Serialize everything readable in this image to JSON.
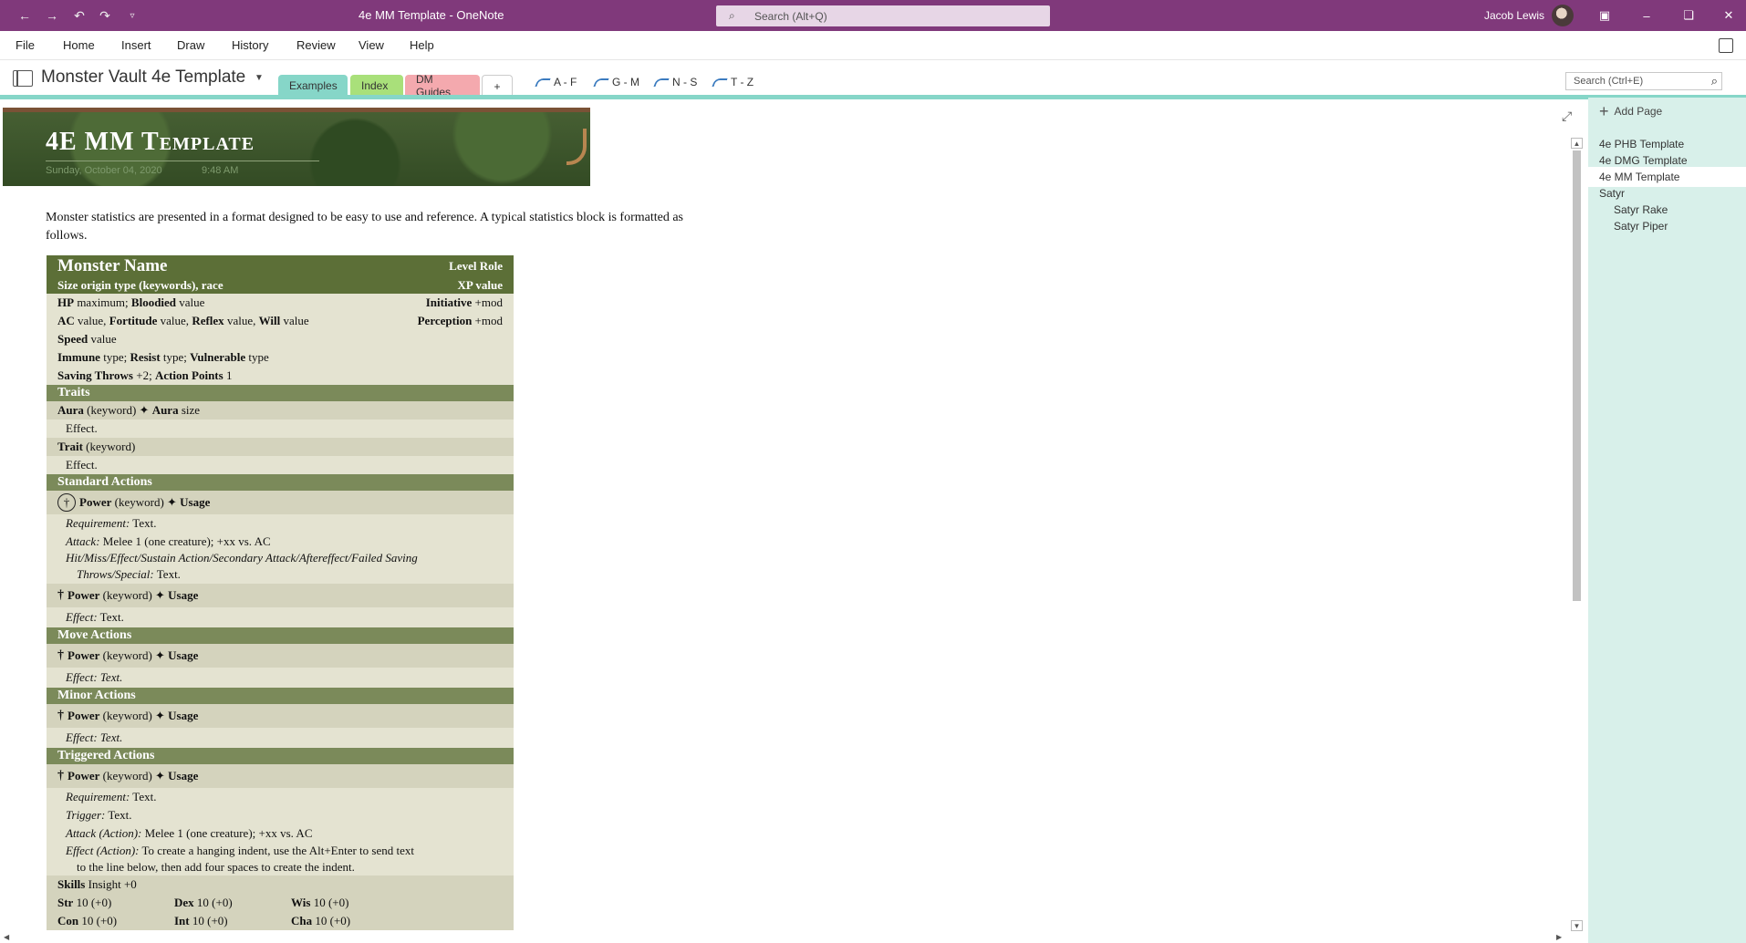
{
  "titlebar": {
    "title": "4e MM Template  -  OneNote",
    "search_placeholder": "Search (Alt+Q)",
    "user": "Jacob Lewis",
    "bg_color": "#80397b"
  },
  "menu": [
    "File",
    "Home",
    "Insert",
    "Draw",
    "History",
    "Review",
    "View",
    "Help"
  ],
  "notebook": {
    "name": "Monster Vault 4e Template",
    "sections": [
      {
        "label": "Examples",
        "color": "#86d6c8"
      },
      {
        "label": "Index",
        "color": "#a9e07a"
      },
      {
        "label": "DM Guides",
        "color": "#f4a9ae"
      }
    ],
    "add_label": "+",
    "groups": [
      "A - F",
      "G - M",
      "N - S",
      "T - Z"
    ],
    "page_search": "Search (Ctrl+E)"
  },
  "pages": {
    "add_label": "Add Page",
    "items": [
      {
        "label": "4e PHB Template",
        "level": 0
      },
      {
        "label": "4e DMG Template",
        "level": 0
      },
      {
        "label": "4e MM Template",
        "level": 0,
        "selected": true
      },
      {
        "label": "Satyr",
        "level": 0
      },
      {
        "label": "Satyr Rake",
        "level": 1
      },
      {
        "label": "Satyr Piper",
        "level": 1
      }
    ]
  },
  "page": {
    "title": "4E MM Template",
    "date": "Sunday, October 04, 2020",
    "time": "9:48 AM",
    "intro": "Monster statistics are presented in a format designed to be easy to use and reference. A typical statistics block is formatted as follows."
  },
  "statblock": {
    "name": "Monster Name",
    "level_role": "Level Role",
    "size_line": "Size origin type (keywords), race",
    "xp": "XP value",
    "hp_b": "HP",
    "hp_1": " maximum; ",
    "bloodied_b": "Bloodied",
    "bloodied_v": " value",
    "init_b": "Initiative",
    "init_v": " +mod",
    "ac_b": "AC",
    "ac_v": " value, ",
    "fort_b": "Fortitude",
    "fort_v": " value, ",
    "ref_b": "Reflex",
    "ref_v": " value, ",
    "will_b": "Will",
    "will_v": " value",
    "perc_b": "Perception",
    "perc_v": " +mod",
    "speed_b": "Speed",
    "speed_v": " value",
    "imm_b": "Immune",
    "imm_v": " type; ",
    "res_b": "Resist",
    "res_v": " type; ",
    "vul_b": "Vulnerable",
    "vul_v": " type",
    "st_b": "Saving Throws",
    "st_v": " +2; ",
    "ap_b": "Action Points",
    "ap_v": " 1",
    "traits": "Traits",
    "aura_b": "Aura",
    "aura_kw": " (keyword) ✦ ",
    "aura_b2": "Aura",
    "aura_sz": " size",
    "effect1": "Effect.",
    "trait_b": "Trait",
    "trait_kw": " (keyword)",
    "effect2": "Effect.",
    "standard": "Standard Actions",
    "power_b": "Power",
    "power_kw": " (keyword) ✦ ",
    "usage_b": "Usage",
    "req_i": "Requirement:",
    "req_t": " Text.",
    "attack_i": "Attack:",
    "attack_t": " Melee 1 (one creature); +xx vs. AC",
    "hit_i": "Hit/Miss/Effect/Sustain Action/Secondary Attack/Aftereffect/Failed Saving",
    "hit_i2": "Throws/Special:",
    "hit_t2": " Text.",
    "effect_i": "Effect:",
    "effect_t": " Text.",
    "move": "Move Actions",
    "effect_text_i": "Effect: Text.",
    "minor": "Minor Actions",
    "triggered": "Triggered Actions",
    "trigger_i": "Trigger:",
    "trigger_t": " Text.",
    "attack_action_i": "Attack (Action):",
    "effect_action_i": "Effect (Action):",
    "effect_action_t": " To create a hanging indent, use the Alt+Enter to send text",
    "effect_action_t2": "to the line below, then add four spaces to create the indent.",
    "skills_b": "Skills",
    "skills_v": " Insight +0",
    "str_b": "Str",
    "str_v": " 10 (+0)",
    "dex_b": "Dex",
    "dex_v": " 10 (+0)",
    "wis_b": "Wis",
    "wis_v": " 10 (+0)",
    "con_b": "Con",
    "con_v": " 10 (+0)",
    "int_b": "Int",
    "int_v": " 10 (+0)",
    "cha_b": "Cha",
    "cha_v": " 10 (+0)"
  }
}
